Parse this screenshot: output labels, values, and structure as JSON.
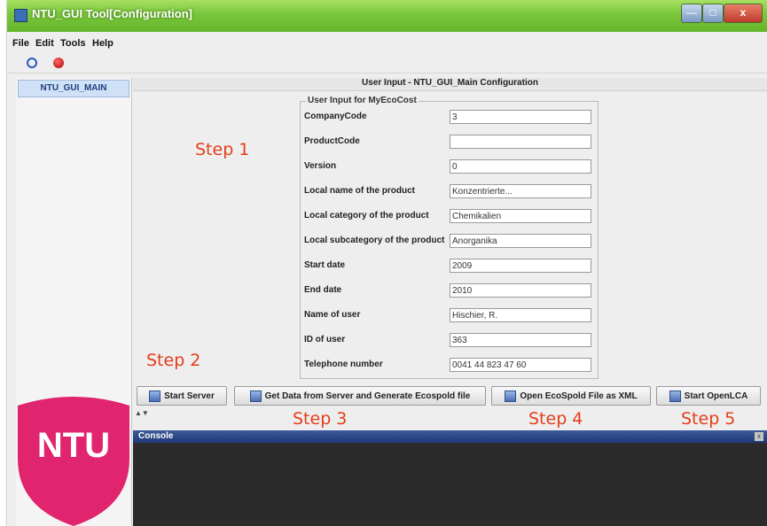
{
  "window": {
    "title": "NTU_GUI Tool[Configuration]",
    "min": "—",
    "max": "□",
    "close": "x"
  },
  "menu": [
    "File",
    "Edit",
    "Tools",
    "Help"
  ],
  "sidebar": {
    "tree_item": "NTU_GUI_MAIN",
    "logo_text": "NTU",
    "logo_color": "#e0246e"
  },
  "main": {
    "panel_title": "User Input - NTU_GUI_Main Configuration",
    "form_legend": "User Input for MyEcoCost",
    "fields": [
      {
        "label": "CompanyCode",
        "value": "3"
      },
      {
        "label": "ProductCode",
        "value": ""
      },
      {
        "label": "Version",
        "value": "0"
      },
      {
        "label": "Local name of the product",
        "value": "Konzentrierte..."
      },
      {
        "label": "Local category of the product",
        "value": "Chemikalien"
      },
      {
        "label": "Local subcategory of the product",
        "value": "Anorganika"
      },
      {
        "label": "Start date",
        "value": "2009"
      },
      {
        "label": "End date",
        "value": "2010"
      },
      {
        "label": "Name of user",
        "value": "Hischier, R."
      },
      {
        "label": "ID of user",
        "value": "363"
      },
      {
        "label": "Telephone number",
        "value": "0041 44 823 47 60"
      }
    ],
    "steps": [
      "Step 1",
      "Step 2",
      "Step 3",
      "Step 4",
      "Step 5"
    ],
    "buttons": {
      "start_server": "Start Server",
      "get_data": "Get Data from Server and Generate Ecospold file",
      "open_xml": "Open EcoSpold File as XML",
      "start_openlca": "Start OpenLCA"
    },
    "divider": "▲▼"
  },
  "console": {
    "title": "Console",
    "close": "x"
  },
  "colors": {
    "titlebar": "#7cc83e",
    "step_text": "#e53d18",
    "console_bg": "#2b2b2b",
    "console_header": "#2b4a8a"
  }
}
